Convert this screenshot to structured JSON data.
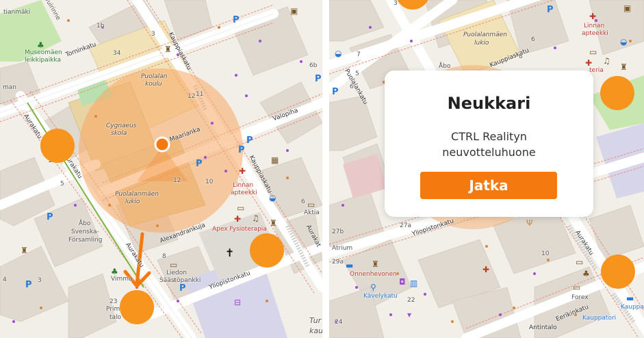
{
  "left_map": {
    "streets": {
      "torninkatu": "Torninkatu",
      "kauppiaskatu_top": "Kauppiaskatu",
      "aurakatu_upper": "Aurakatu",
      "aurakatu_mid": "Aurakatu",
      "aurakatu_lower": "Aurakatu",
      "maarianka": "Maarianka",
      "kauppiaskatu_right": "Kauppiaskatu",
      "valopiha": "Valopiha",
      "alexandrankuja": "Alexandrankuja",
      "yliopistonkatu": "Yliopistonkatu",
      "aurakatu_corner": "Aurakat"
    },
    "places": {
      "museomaen": "Museomäen",
      "leikkipaikka": "leikkipaikka",
      "puolalan": "Puolalan",
      "koulu": "koulu",
      "cygnaeus": "Cygnaeus",
      "skola": "skola",
      "puolalanmaen": "Puolalanmäen",
      "lukio": "lukio",
      "linnan": "Linnan",
      "apteekki": "apteekki",
      "apex": "Apex Fysioterapia",
      "abo": "Åbo",
      "svenska": "Svenska-",
      "forsamling": "Församling",
      "liedon": "Liedon",
      "saastopankki": "Säästöpankki",
      "vimma": "Vimma",
      "prima": "Prim",
      "talo": "talo",
      "aktia": "Aktia",
      "tur": "Tur",
      "kau": "kau",
      "tianmaki": "tianmäki",
      "vuirinne": "vuirinne",
      "man": "man"
    },
    "numbers": {
      "n1b": "1b",
      "n3": "3",
      "n34": "34",
      "n6b": "6b",
      "n11": "11",
      "n10": "10",
      "n12": "12",
      "n12b": "12",
      "n6": "6",
      "n1": "1",
      "n8": "8",
      "n3b": "3",
      "n23": "23",
      "n5": "5",
      "n4": "4"
    },
    "parking_label": "P",
    "cross_glyph": "✝",
    "arrow_color": "#f47a0f",
    "radius_color": "#f7b27a"
  },
  "right_map": {
    "streets": {
      "puolalankatu": "Puolalankatu",
      "yliopistonkatu": "Yliopistonkatu",
      "aurakatu": "Aurakatu",
      "eerikinkatu": "Eerikinkatu",
      "kauppiaskatu": "Kauppiaskatu",
      "antintalo": "Antintalo"
    },
    "places": {
      "puolalanmaen": "Puolalanmäen",
      "lukio": "lukio",
      "linnan": "Linnan",
      "apteekki": "apteekki",
      "ateria": "teria",
      "abo": "Åbo",
      "atrium": "Atrium",
      "onnenhevonen": "Onnenhevonen",
      "kavelykatu": "Kävelykatu",
      "forex": "Forex",
      "kauppatori": "Kauppatori",
      "kauppa": "Kauppa"
    },
    "numbers": {
      "n5": "5",
      "n6": "6",
      "n7": "7",
      "n8": "8",
      "n10": "10",
      "n27b": "27b",
      "n27a": "27a",
      "n29a": "29a",
      "n22": "22",
      "n24": "24",
      "n3": "3",
      "n6b": "6"
    },
    "parking_label": "P"
  },
  "modal": {
    "title": "Neukkari",
    "subtitle_line1": "CTRL Realityn",
    "subtitle_line2": "neuvotteluhuone",
    "button_label": "Jatka",
    "button_color": "#f47a0f"
  },
  "markers": {
    "color": "#f7941d"
  }
}
